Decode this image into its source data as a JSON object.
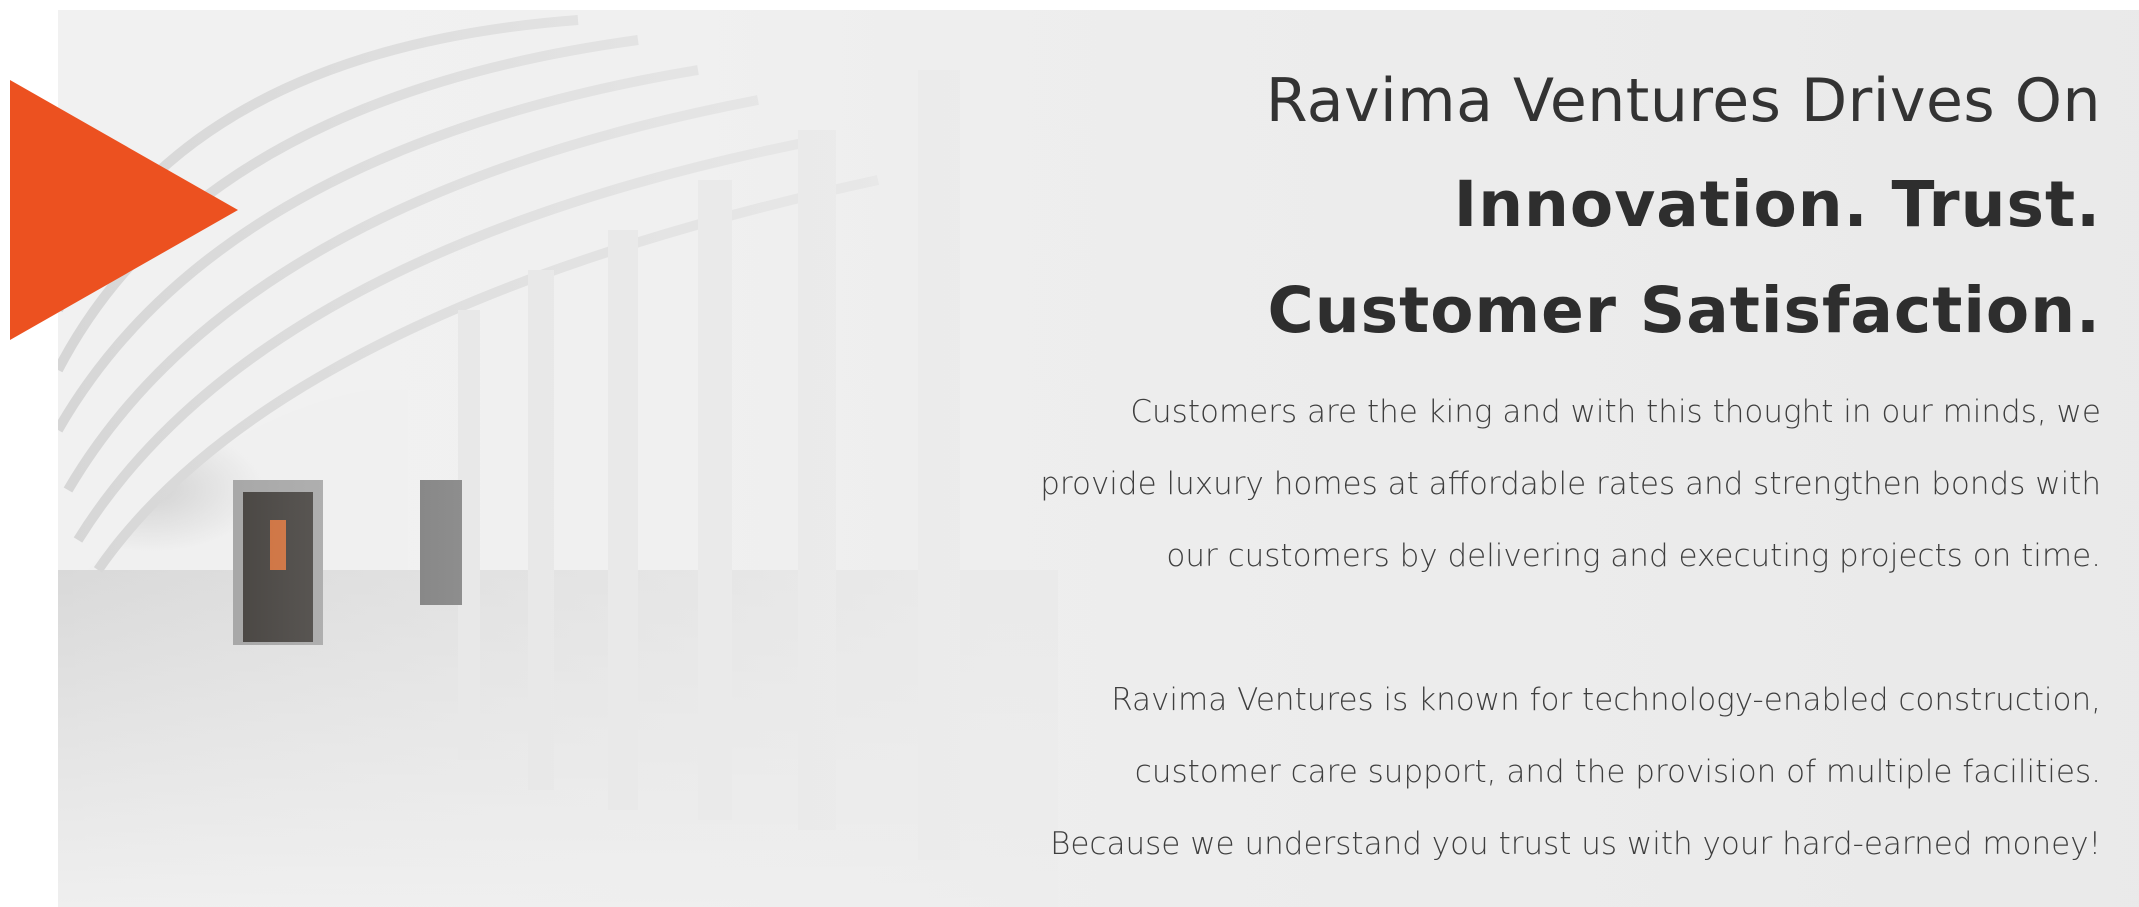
{
  "hero": {
    "headline_line1": "Ravima Ventures Drives On",
    "headline_line2": "Innovation. Trust.",
    "headline_line3": "Customer Satisfaction.",
    "paragraph1": {
      "line1": "Customers are the king and with this thought in our minds, we",
      "line2": "provide luxury homes at affordable rates and strengthen bonds with",
      "line3": "our customers by delivering and executing projects on time."
    },
    "paragraph2": {
      "line1": "Ravima Ventures is known for technology-enabled construction,",
      "line2": "customer care support, and the provision of multiple facilities.",
      "line3": "Because we understand you trust us with your hard-earned money!"
    }
  },
  "colors": {
    "accent": "#ec5120",
    "heading_text": "#333333",
    "body_text": "#3e3e3e"
  },
  "icons": {
    "accent_shape": "play-triangle-icon"
  }
}
